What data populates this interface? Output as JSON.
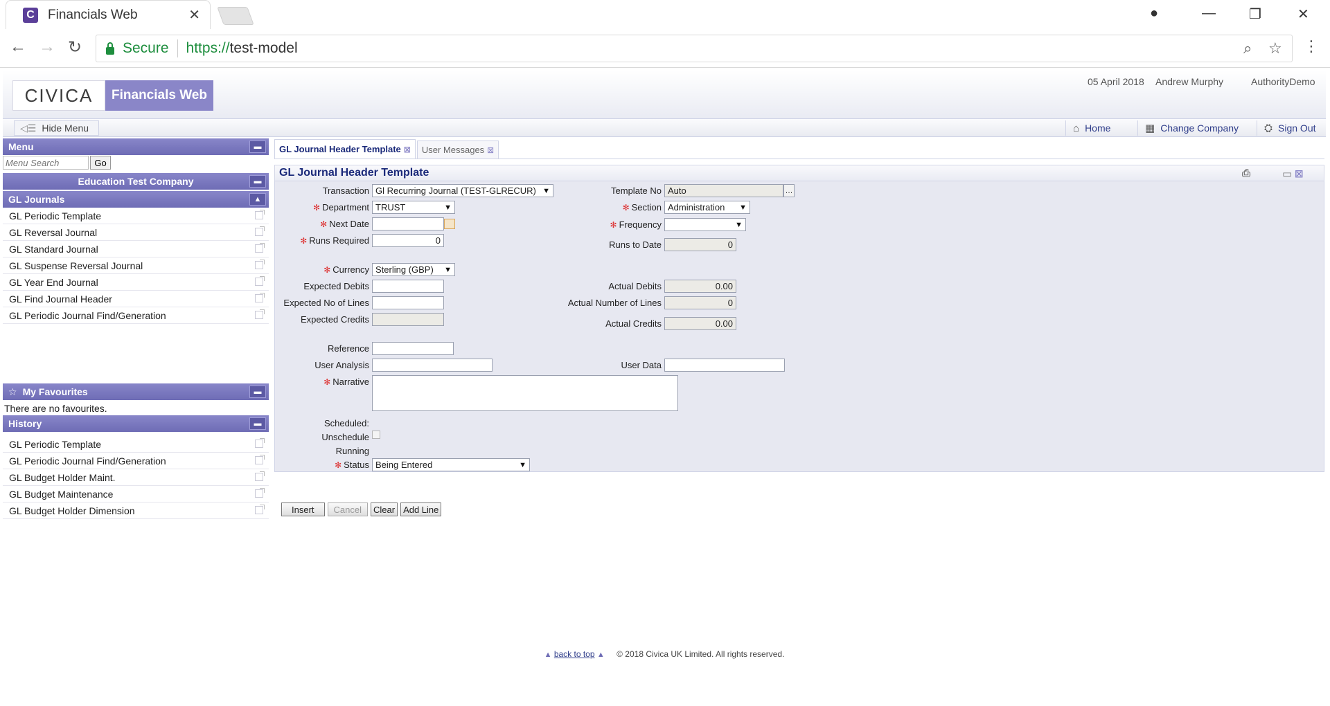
{
  "browser": {
    "tab_title": "Financials Web",
    "favicon_letter": "C",
    "secure_label": "Secure",
    "url_scheme": "https://",
    "url_host": "test-model"
  },
  "header": {
    "logo_text": "CIVICA",
    "product_name": "Financials Web",
    "date": "05 April 2018",
    "user": "Andrew Murphy",
    "authority": "AuthorityDemo"
  },
  "nav": {
    "hide_menu": "Hide Menu",
    "home": "Home",
    "change_company": "Change Company",
    "sign_out": "Sign Out"
  },
  "sidebar": {
    "menu_title": "Menu",
    "search_placeholder": "Menu Search",
    "go_label": "Go",
    "company": "Education Test Company",
    "section_title": "GL Journals",
    "items": [
      "GL Periodic Template",
      "GL Reversal Journal",
      "GL Standard Journal",
      "GL Suspense Reversal Journal",
      "GL Year End Journal",
      "GL Find Journal Header",
      "GL Periodic Journal Find/Generation"
    ],
    "favourites_title": "My Favourites",
    "no_favourites": "There are no favourites.",
    "history_title": "History",
    "history": [
      "GL Periodic Template",
      "GL Periodic Journal Find/Generation",
      "GL Budget Holder Maint.",
      "GL Budget Maintenance",
      "GL Budget Holder Dimension"
    ]
  },
  "tabs": [
    {
      "label": "GL Journal Header Template"
    },
    {
      "label": "User Messages"
    }
  ],
  "form": {
    "title": "GL Journal Header Template",
    "transaction_label": "Transaction",
    "transaction_value": "Gl Recurring Journal (TEST-GLRECUR)",
    "template_no_label": "Template No",
    "template_no_value": "Auto",
    "department_label": "Department",
    "department_value": "TRUST",
    "section_label": "Section",
    "section_value": "Administration",
    "next_date_label": "Next Date",
    "frequency_label": "Frequency",
    "runs_required_label": "Runs Required",
    "runs_required_value": "0",
    "runs_to_date_label": "Runs to Date",
    "runs_to_date_value": "0",
    "currency_label": "Currency",
    "currency_value": "Sterling (GBP)",
    "expected_debits_label": "Expected Debits",
    "actual_debits_label": "Actual Debits",
    "actual_debits_value": "0.00",
    "expected_lines_label": "Expected No of Lines",
    "actual_lines_label": "Actual Number of Lines",
    "actual_lines_value": "0",
    "expected_credits_label": "Expected Credits",
    "actual_credits_label": "Actual Credits",
    "actual_credits_value": "0.00",
    "reference_label": "Reference",
    "user_analysis_label": "User Analysis",
    "user_data_label": "User Data",
    "narrative_label": "Narrative",
    "scheduled_label": "Scheduled:",
    "unschedule_label": "Unschedule",
    "running_label": "Running",
    "status_label": "Status",
    "status_value": "Being Entered"
  },
  "buttons": {
    "insert": "Insert",
    "cancel": "Cancel",
    "clear": "Clear",
    "add_line": "Add Line"
  },
  "footer": {
    "back_to_top": "back to top",
    "copyright": "© 2018 Civica UK Limited. All rights reserved."
  }
}
